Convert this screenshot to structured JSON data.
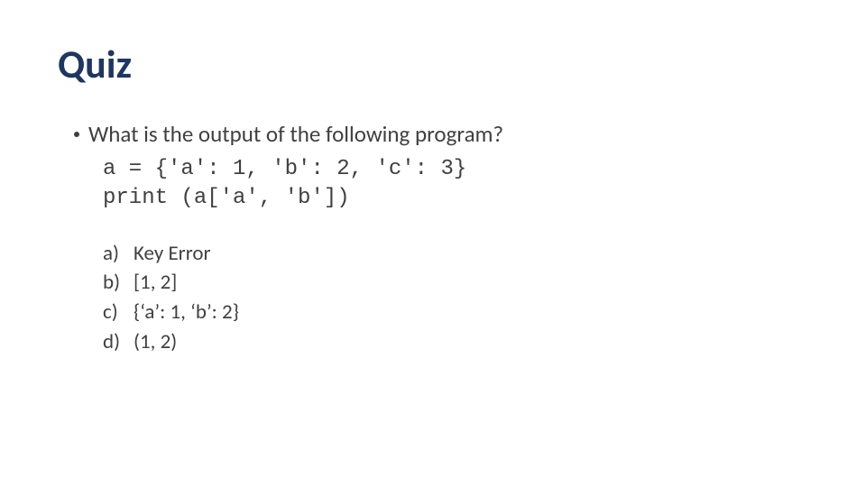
{
  "title": "Quiz",
  "question": "What is the output of the following program?",
  "code_line1": "a = {'a': 1, 'b': 2, 'c': 3}",
  "code_line2": "print (a['a', 'b'])",
  "options": {
    "a": {
      "letter": "a)",
      "text": "Key Error"
    },
    "b": {
      "letter": "b)",
      "text": "[1, 2]"
    },
    "c": {
      "letter": "c)",
      "text": "{‘a’: 1, ‘b’: 2}"
    },
    "d": {
      "letter": "d)",
      "text": "(1, 2)"
    }
  }
}
